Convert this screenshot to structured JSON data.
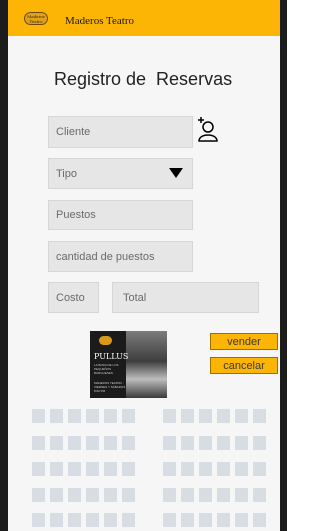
{
  "header": {
    "logo_text": "Maderos Teatro",
    "app_title": "Maderos Teatro"
  },
  "page_title": "Registro de  Reservas",
  "form": {
    "cliente_placeholder": "Cliente",
    "tipo_placeholder": "Tipo",
    "puestos_placeholder": "Puestos",
    "cantidad_placeholder": "cantidad de puestos",
    "costo_label": "Costo",
    "total_placeholder": "Total"
  },
  "icons": {
    "add_client": "add-user-icon",
    "tipo_dropdown": "caret-down-icon"
  },
  "poster": {
    "title": "PULLUS",
    "subtitle": "LA BODA DE LOS PEQUEÑOS BURGUESES",
    "footer": "MADEROS TEATRO · VIERNES Y SÁBADOS 8:00 PM"
  },
  "buttons": {
    "vender": "vender",
    "cancelar": "cancelar"
  },
  "colors": {
    "header": "#fcb405",
    "buttons": "#fcb405",
    "seat": "#d8dde3",
    "field": "#e6e6e6"
  },
  "seat_map": {
    "rows": 5,
    "blocks": 2,
    "seats_per_block": 6
  }
}
